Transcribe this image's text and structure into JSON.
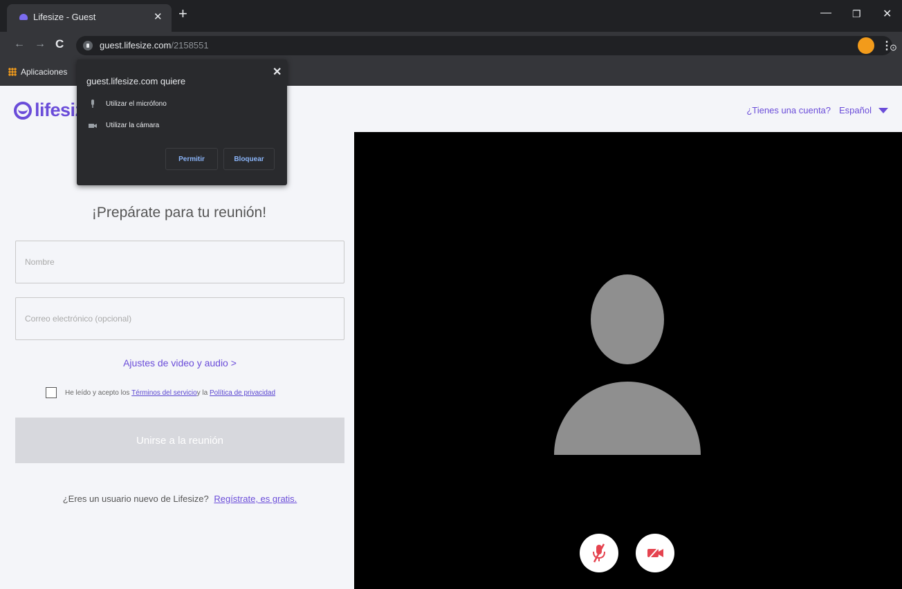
{
  "browser": {
    "tab_title": "Lifesize - Guest",
    "url_host": "guest.lifesize.com",
    "url_path": "/2158551",
    "bookmark_label": "Aplicaciones"
  },
  "permission_popup": {
    "title": "guest.lifesize.com quiere",
    "microphone_label": "Utilizar el micrófono",
    "camera_label": "Utilizar la cámara",
    "allow_label": "Permitir",
    "block_label": "Bloquear"
  },
  "header": {
    "logo_text": "lifesize",
    "account_link": "¿Tienes una cuenta?",
    "language": "Español"
  },
  "form": {
    "title": "¡Prepárate para tu reunión!",
    "name_placeholder": "Nombre",
    "email_placeholder": "Correo electrónico (opcional)",
    "av_settings_link": "Ajustes de video y audio >",
    "terms_prefix": "He leído y acepto los ",
    "terms_link": "Términos del servicio",
    "terms_middle": " y la ",
    "privacy_link": "Política de privacidad",
    "join_button": "Unirse a la reunión",
    "signup_text": "¿Eres un usuario nuevo de Lifesize?",
    "signup_link": "Regístrate, es gratis."
  },
  "video_preview": {
    "mic_state": "muted",
    "camera_state": "off",
    "icon_color": "#e5434f"
  },
  "colors": {
    "brand": "#6a4cd9",
    "chrome_dark": "#202124",
    "chrome_toolbar": "#35363a"
  }
}
